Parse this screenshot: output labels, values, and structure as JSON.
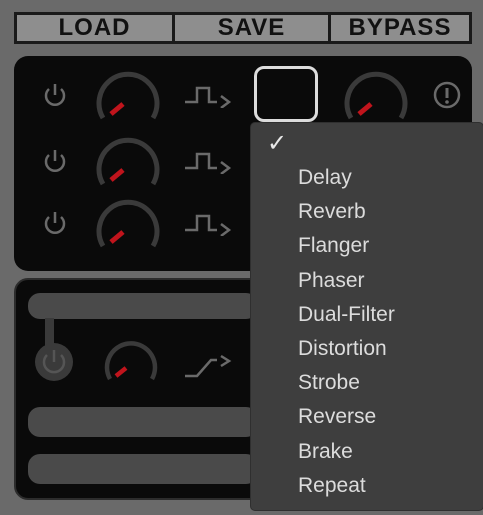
{
  "toolbar": {
    "load_label": "LOAD",
    "save_label": "SAVE",
    "bypass_label": "BYPASS"
  },
  "effects_menu": {
    "selected_mark": "✓",
    "items": [
      "Delay",
      "Reverb",
      "Flanger",
      "Phaser",
      "Dual-Filter",
      "Distortion",
      "Strobe",
      "Reverse",
      "Brake",
      "Repeat"
    ]
  },
  "colors": {
    "knob_indicator": "#c0141c",
    "background": "#6a6a6a",
    "panel": "#0a0a0a",
    "menu": "#3e3e3e"
  },
  "icons": [
    "power-icon",
    "knob",
    "step-shape-icon",
    "ramp-shape-icon",
    "info-icon",
    "checkmark-icon"
  ]
}
